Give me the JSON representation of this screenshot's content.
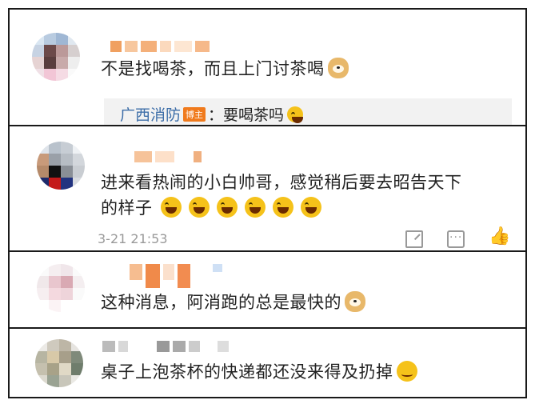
{
  "comments": [
    {
      "text": "不是找喝茶，而且上门讨茶喝",
      "emojis": [
        "doge"
      ],
      "reply": {
        "author": "广西消防",
        "badge": "博主",
        "text": "：要喝茶吗",
        "emojis": [
          "laugh"
        ]
      }
    },
    {
      "text_line1": "进来看热闹的小白帅哥，感觉稍后要去昭告天下",
      "text_line2": "的样子",
      "emojis": [
        "laugh",
        "laugh",
        "laugh",
        "laugh",
        "laugh",
        "laugh"
      ],
      "timestamp": "3-21 21:53",
      "actions": [
        "share-icon",
        "comment-icon",
        "like-icon"
      ]
    },
    {
      "text": "这种消息，阿消跑的总是最快的",
      "emojis": [
        "doge"
      ]
    },
    {
      "text": "桌子上泡茶杯的快递都还没来得及扔掉",
      "emojis": [
        "smirk"
      ]
    }
  ],
  "colors": {
    "link_blue": "#3d6ea8",
    "badge_orange": "#f07a1c",
    "text": "#222222",
    "meta": "#999999"
  }
}
